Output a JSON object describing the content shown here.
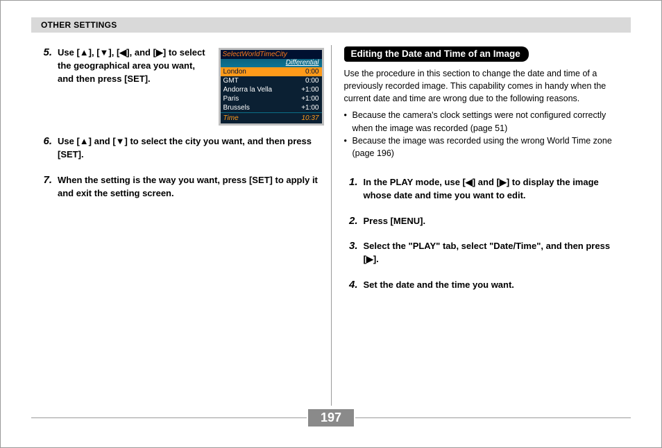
{
  "header": {
    "title": "OTHER SETTINGS"
  },
  "page_number": "197",
  "left": {
    "steps": [
      {
        "num": "5.",
        "text_html": "Use [▲], [▼], [◀], and [▶] to select the geographical area you want, and then press [SET]."
      },
      {
        "num": "6.",
        "text_html": "Use [▲] and [▼] to select the city you want, and then press [SET]."
      },
      {
        "num": "7.",
        "text_html": "When the setting is the way you want, press [SET] to apply it and exit the setting screen."
      }
    ],
    "lcd": {
      "title": "SelectWorldTimeCity",
      "label_diff": "Differential",
      "rows": [
        {
          "city": "London",
          "diff": "0:00",
          "selected": true
        },
        {
          "city": "GMT",
          "diff": "0:00"
        },
        {
          "city": "Andorra la Vella",
          "diff": "+1:00"
        },
        {
          "city": "Paris",
          "diff": "+1:00"
        },
        {
          "city": "Brussels",
          "diff": "+1:00"
        }
      ],
      "footer_label": "Time",
      "footer_value": "10:37"
    }
  },
  "right": {
    "heading": "Editing the Date and Time of an Image",
    "intro": "Use the procedure in this section to change the date and time of a previously recorded image. This capability comes in handy when the current date and time are wrong due to the following reasons.",
    "bullets": [
      "Because the camera's clock settings were not configured correctly when the image was recorded (page 51)",
      "Because the image was recorded using the wrong World Time zone (page 196)"
    ],
    "steps": [
      {
        "num": "1.",
        "text_html": "In the PLAY mode, use [◀] and [▶] to display the image whose date and time you want to edit."
      },
      {
        "num": "2.",
        "text_html": "Press [MENU]."
      },
      {
        "num": "3.",
        "text_html": "Select the \"PLAY\" tab, select \"Date/Time\", and then press [▶]."
      },
      {
        "num": "4.",
        "text_html": "Set the date and the time you want."
      }
    ]
  }
}
